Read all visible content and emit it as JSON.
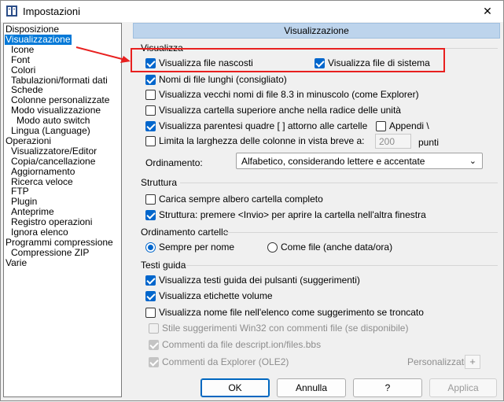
{
  "window": {
    "title": "Impostazioni"
  },
  "tree": {
    "items": [
      {
        "label": "Disposizione",
        "indent": 0,
        "selected": false
      },
      {
        "label": "Visualizzazione",
        "indent": 0,
        "selected": true
      },
      {
        "label": "Icone",
        "indent": 1,
        "selected": false
      },
      {
        "label": "Font",
        "indent": 1,
        "selected": false
      },
      {
        "label": "Colori",
        "indent": 1,
        "selected": false
      },
      {
        "label": "Tabulazioni/formati dati",
        "indent": 1,
        "selected": false
      },
      {
        "label": "Schede",
        "indent": 1,
        "selected": false
      },
      {
        "label": "Colonne personalizzate",
        "indent": 1,
        "selected": false
      },
      {
        "label": "Modo visualizzazione",
        "indent": 1,
        "selected": false
      },
      {
        "label": "Modo auto switch",
        "indent": 2,
        "selected": false
      },
      {
        "label": "Lingua (Language)",
        "indent": 1,
        "selected": false
      },
      {
        "label": "Operazioni",
        "indent": 0,
        "selected": false
      },
      {
        "label": "Visualizzatore/Editor",
        "indent": 1,
        "selected": false
      },
      {
        "label": "Copia/cancellazione",
        "indent": 1,
        "selected": false
      },
      {
        "label": "Aggiornamento",
        "indent": 1,
        "selected": false
      },
      {
        "label": "Ricerca veloce",
        "indent": 1,
        "selected": false
      },
      {
        "label": "FTP",
        "indent": 1,
        "selected": false
      },
      {
        "label": "Plugin",
        "indent": 1,
        "selected": false
      },
      {
        "label": "Anteprime",
        "indent": 1,
        "selected": false
      },
      {
        "label": "Registro operazioni",
        "indent": 1,
        "selected": false
      },
      {
        "label": "Ignora elenco",
        "indent": 1,
        "selected": false
      },
      {
        "label": "Programmi compressione",
        "indent": 0,
        "selected": false
      },
      {
        "label": "Compressione ZIP",
        "indent": 1,
        "selected": false
      },
      {
        "label": "Varie",
        "indent": 0,
        "selected": false
      }
    ]
  },
  "panel": {
    "header": "Visualizzazione",
    "visualizza": {
      "title": "Visualizza",
      "show_hidden": {
        "label": "Visualizza file nascosti",
        "checked": true
      },
      "show_system": {
        "label": "Visualizza file di sistema",
        "checked": true
      },
      "long_names": {
        "label": "Nomi di file lunghi (consigliato)",
        "checked": true
      },
      "old_names": {
        "label": "Visualizza vecchi nomi di file 8.3 in minuscolo (come Explorer)",
        "checked": false
      },
      "parent_root": {
        "label": "Visualizza cartella superiore anche nella radice delle unità",
        "checked": false
      },
      "brackets": {
        "label": "Visualizza parentesi quadre [ ] attorno alle cartelle",
        "checked": true
      },
      "append": {
        "label": "Appendi \\",
        "checked": false
      },
      "limit_width": {
        "label": "Limita la larghezza delle colonne in vista breve a:",
        "checked": false
      },
      "width_value": "200",
      "width_unit": "punti",
      "sort_label": "Ordinamento:",
      "sort_value": "Alfabetico, considerando lettere e accentate"
    },
    "struttura": {
      "title": "Struttura",
      "load_tree": {
        "label": "Carica sempre albero cartella completo",
        "checked": false
      },
      "enter_tab": {
        "label": "Struttura: premere <Invio> per aprire la cartella nell'altra finestra",
        "checked": true
      }
    },
    "ordinamento": {
      "title": "Ordinamento cartelle",
      "by_name": {
        "label": "Sempre per nome",
        "selected": true
      },
      "as_files": {
        "label": "Come file (anche data/ora)",
        "selected": false
      }
    },
    "testi": {
      "title": "Testi guida",
      "buttons": {
        "label": "Visualizza testi guida dei pulsanti (suggerimenti)",
        "checked": true
      },
      "volume": {
        "label": "Visualizza etichette volume",
        "checked": true
      },
      "truncated": {
        "label": "Visualizza nome file nell'elenco come suggerimento se troncato",
        "checked": false
      },
      "win32": {
        "label": "Stile suggerimenti Win32 con commenti file (se disponibile)",
        "checked": false
      },
      "descript": {
        "label": "Commenti da file descript.ion/files.bbs",
        "checked": true
      },
      "explorer": {
        "label": "Commenti da Explorer (OLE2)",
        "checked": true
      },
      "custom_label": "Personalizzati:",
      "custom_plus": "+"
    }
  },
  "buttons": {
    "ok": "OK",
    "cancel": "Annulla",
    "help": "?",
    "apply": "Applica"
  },
  "colors": {
    "accent": "#0066cc",
    "selection": "#0078d7",
    "header_bg": "#bdd4ec",
    "annotation": "#e8201f"
  }
}
